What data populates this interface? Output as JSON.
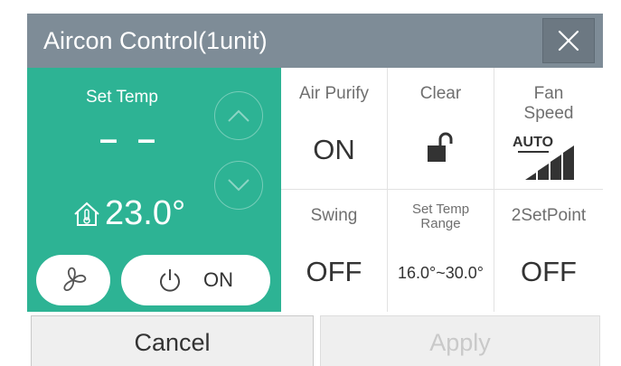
{
  "dialog": {
    "title": "Aircon Control(1unit)"
  },
  "left": {
    "set_temp_label": "Set Temp",
    "set_temp_value": "– –",
    "room_temp_value": "23.0°",
    "power_label": "ON"
  },
  "grid": {
    "air_purify": {
      "label": "Air Purify",
      "value": "ON"
    },
    "clear": {
      "label": "Clear"
    },
    "fan_speed": {
      "label_line1": "Fan",
      "label_line2": "Speed",
      "value": "AUTO"
    },
    "swing": {
      "label": "Swing",
      "value": "OFF"
    },
    "set_temp_range": {
      "label_line1": "Set Temp",
      "label_line2": "Range",
      "value": "16.0°~30.0°"
    },
    "two_setpoint": {
      "label": "2SetPoint",
      "value": "OFF"
    }
  },
  "footer": {
    "cancel_label": "Cancel",
    "apply_label": "Apply"
  },
  "colors": {
    "header": "#7e8c97",
    "accent": "#2db394",
    "text": "#333333"
  },
  "icons": [
    "close-icon",
    "chevron-up-icon",
    "chevron-down-icon",
    "house-thermometer-icon",
    "fan-icon",
    "power-icon",
    "unlock-icon",
    "fan-speed-bars-icon"
  ]
}
